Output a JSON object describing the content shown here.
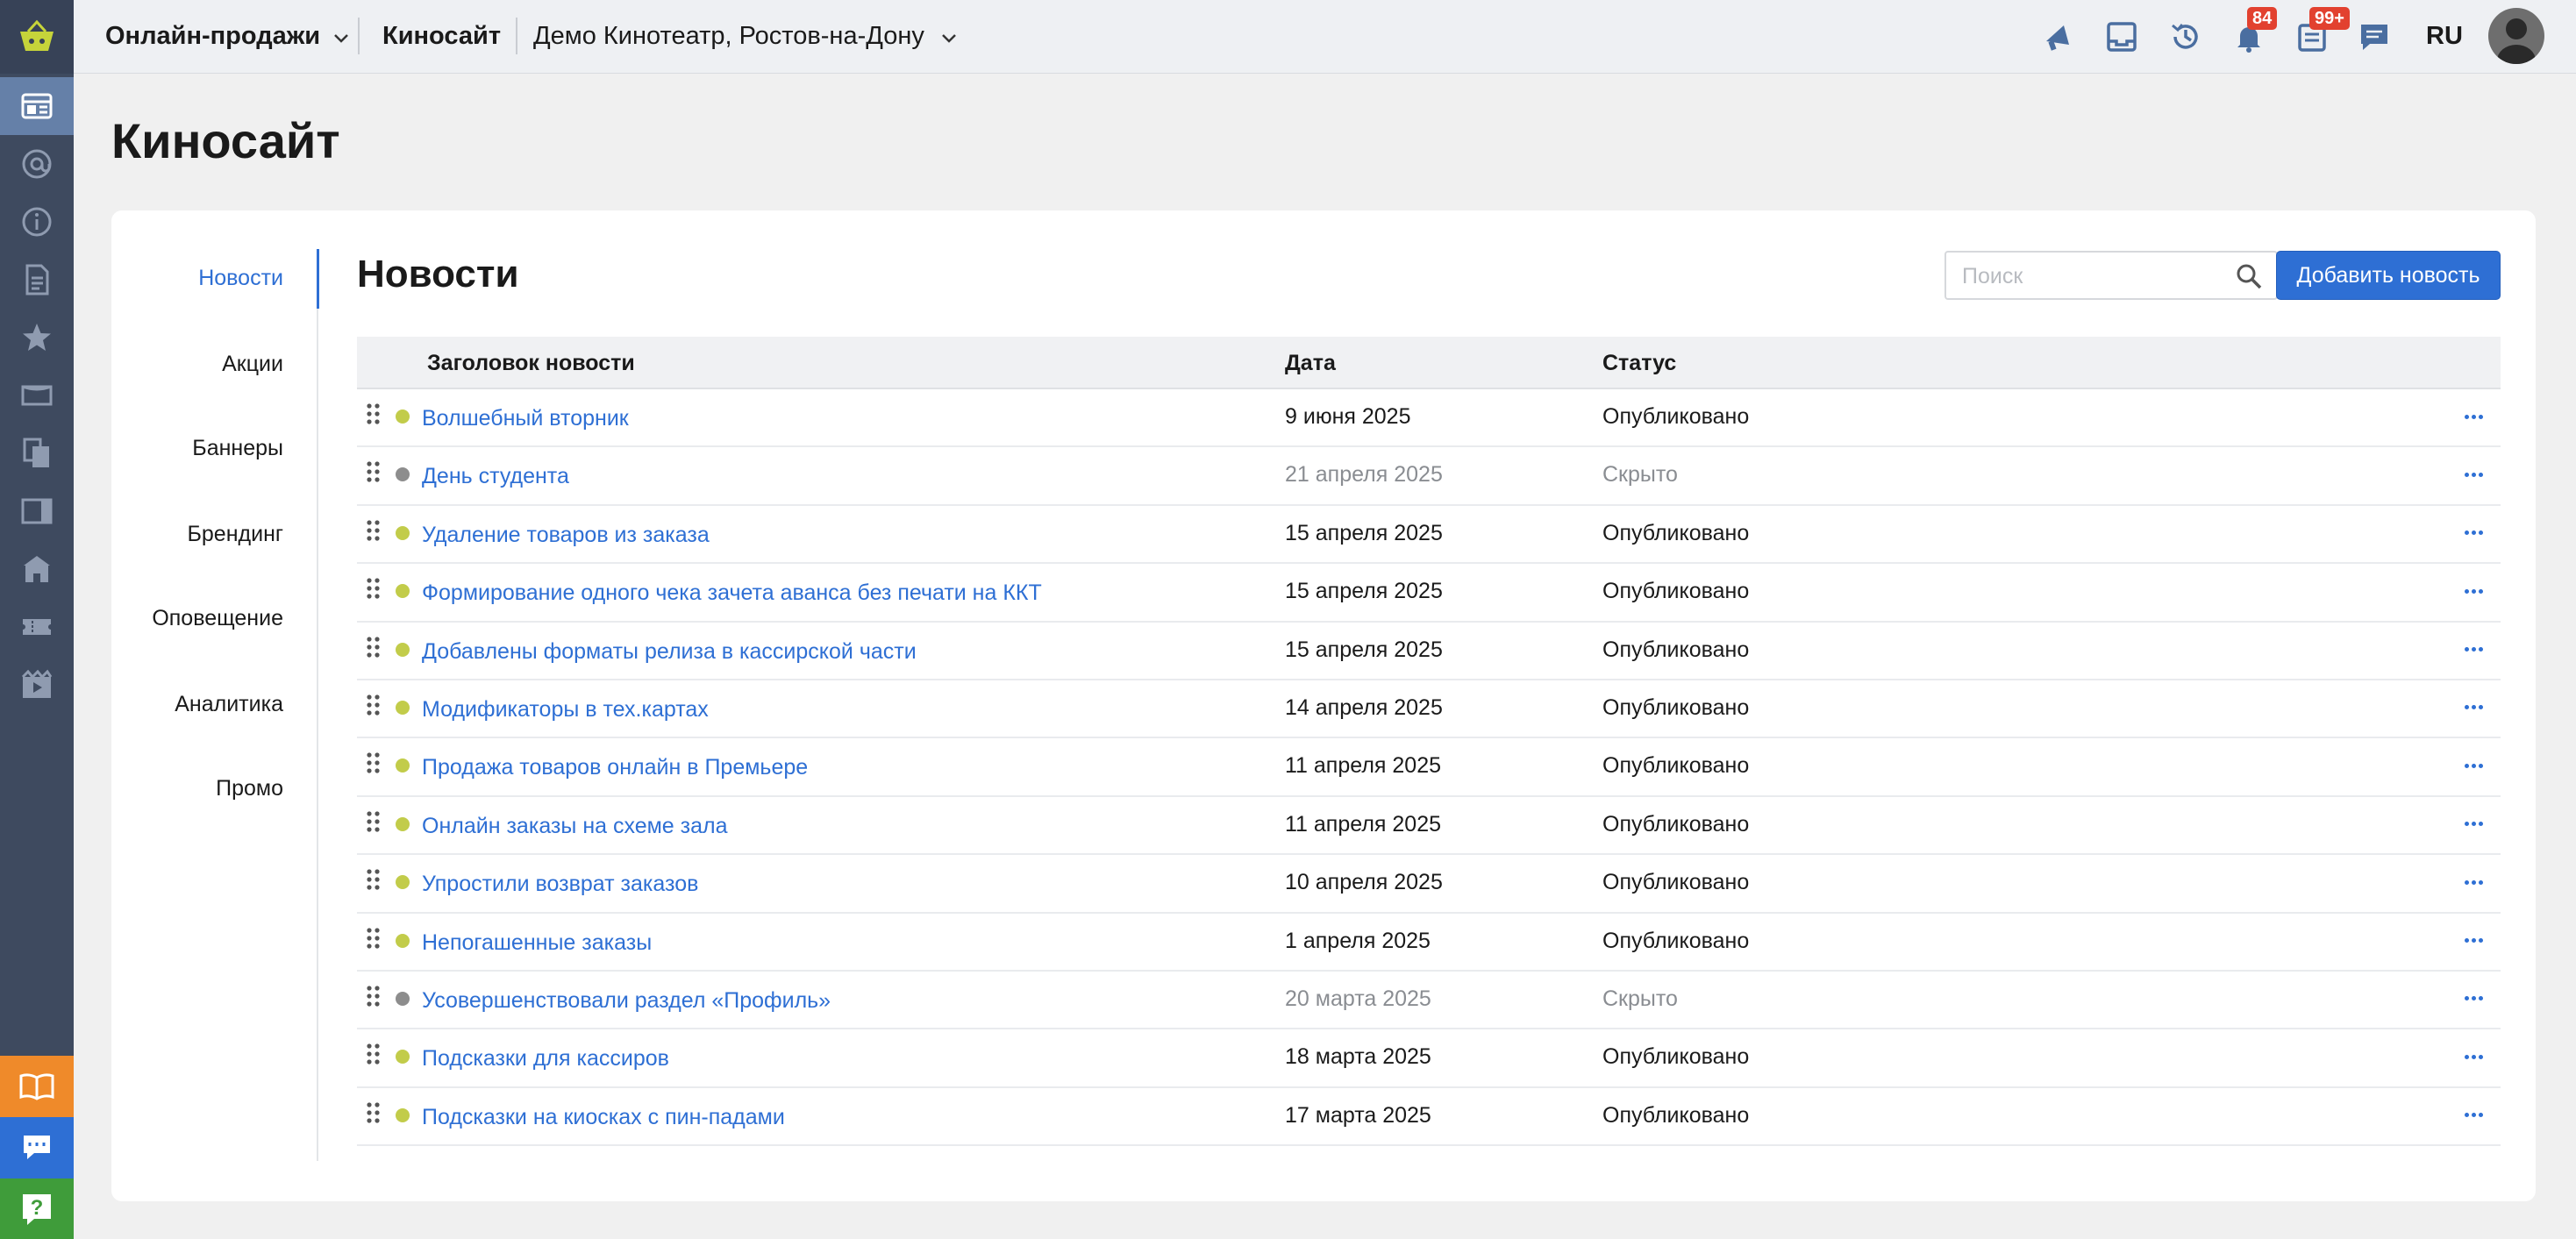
{
  "topbar": {
    "product": "Онлайн-продажи",
    "site": "Киносайт",
    "cinema": "Демо Кинотеатр, Ростов-на-Дону",
    "notifications_count": "84",
    "tasks_count": "99+",
    "language": "RU"
  },
  "sidebar": {
    "icons": [
      "basket-logo-icon",
      "dashboard-icon",
      "at-sign-icon",
      "info-icon",
      "document-icon",
      "star-icon",
      "ticket-icon",
      "copy-icon",
      "panel-icon",
      "building-icon",
      "tickets-icon",
      "film-icon"
    ],
    "bottom": [
      "book-icon",
      "chat-icon",
      "help-icon"
    ]
  },
  "page": {
    "title": "Киносайт"
  },
  "subnav": {
    "items": [
      "Новости",
      "Акции",
      "Баннеры",
      "Брендинг",
      "Оповещение",
      "Аналитика",
      "Промо"
    ],
    "active": "Новости"
  },
  "section": {
    "title": "Новости",
    "search_placeholder": "Поиск",
    "add_button": "Добавить новость"
  },
  "table": {
    "columns": [
      "Заголовок новости",
      "Дата",
      "Статус"
    ],
    "rows": [
      {
        "title": "Волшебный вторник",
        "date": "9 июня 2025",
        "status": "Опубликовано",
        "published": true
      },
      {
        "title": "День студента",
        "date": "21 апреля 2025",
        "status": "Скрыто",
        "published": false
      },
      {
        "title": "Удаление товаров из заказа",
        "date": "15 апреля 2025",
        "status": "Опубликовано",
        "published": true
      },
      {
        "title": "Формирование одного чека зачета аванса без печати на ККТ",
        "date": "15 апреля 2025",
        "status": "Опубликовано",
        "published": true
      },
      {
        "title": "Добавлены форматы релиза в кассирской части",
        "date": "15 апреля 2025",
        "status": "Опубликовано",
        "published": true
      },
      {
        "title": "Модификаторы в тех.картах",
        "date": "14 апреля 2025",
        "status": "Опубликовано",
        "published": true
      },
      {
        "title": "Продажа товаров онлайн в Премьере",
        "date": "11 апреля 2025",
        "status": "Опубликовано",
        "published": true
      },
      {
        "title": "Онлайн заказы на схеме зала",
        "date": "11 апреля 2025",
        "status": "Опубликовано",
        "published": true
      },
      {
        "title": "Упростили возврат заказов",
        "date": "10 апреля 2025",
        "status": "Опубликовано",
        "published": true
      },
      {
        "title": "Непогашенные заказы",
        "date": "1 апреля 2025",
        "status": "Опубликовано",
        "published": true
      },
      {
        "title": "Усовершенствовали раздел «Профиль»",
        "date": "20 марта 2025",
        "status": "Скрыто",
        "published": false
      },
      {
        "title": "Подсказки для кассиров",
        "date": "18 марта 2025",
        "status": "Опубликовано",
        "published": true
      },
      {
        "title": "Подсказки на киосках с пин-падами",
        "date": "17 марта 2025",
        "status": "Опубликовано",
        "published": true
      }
    ]
  },
  "colors": {
    "accent": "#2e6fd4",
    "published_dot": "#c2cc4a",
    "hidden_dot": "#8d8d8d",
    "sidebar": "#3e4a5f",
    "badge": "#e2412f"
  }
}
